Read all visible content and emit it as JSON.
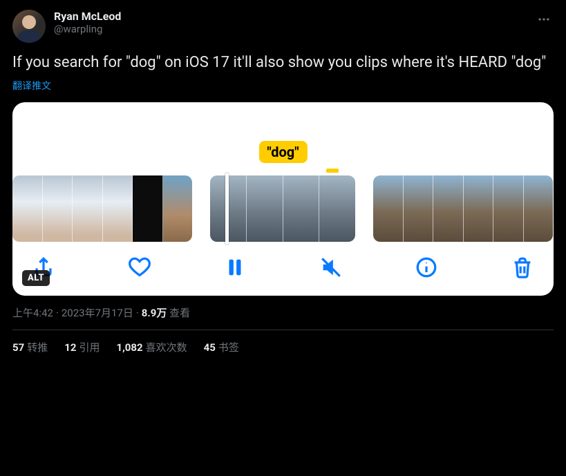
{
  "author": {
    "display_name": "Ryan McLeod",
    "handle": "@warpling"
  },
  "tweet_text": "If you search for \"dog\" on iOS 17 it'll also show you clips where it's HEARD \"dog\"",
  "translate_label": "翻译推文",
  "media": {
    "search_term_label": "\"dog\"",
    "alt_badge": "ALT"
  },
  "meta": {
    "time": "上午4:42",
    "date": "2023年7月17日",
    "views_count": "8.9万",
    "views_label": "查看"
  },
  "stats": {
    "retweets_count": "57",
    "retweets_label": "转推",
    "quotes_count": "12",
    "quotes_label": "引用",
    "likes_count": "1,082",
    "likes_label": "喜欢次数",
    "bookmarks_count": "45",
    "bookmarks_label": "书签"
  }
}
